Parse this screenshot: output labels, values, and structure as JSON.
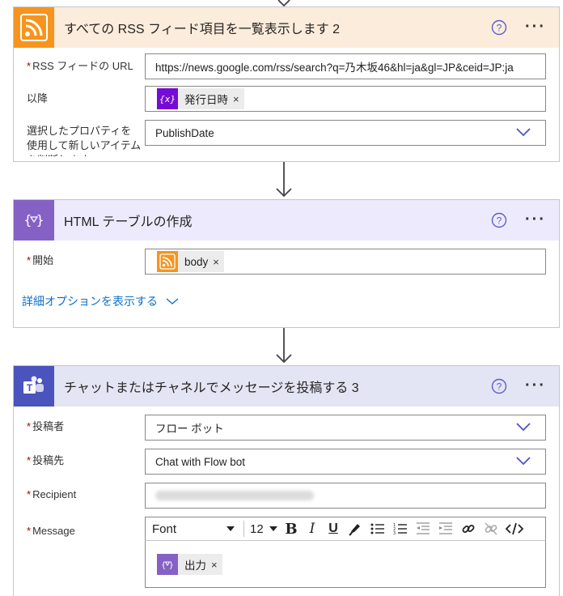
{
  "rss_card": {
    "title": "すべての RSS フィード項目を一覧表示します 2",
    "header_color": "#fcecdc",
    "icon_color": "#f7941d",
    "fields": {
      "url_label": "RSS フィードの URL",
      "url_value": "https://news.google.com/rss/search?q=乃木坂46&hl=ja&gl=JP&ceid=JP:ja",
      "since_label": "以降",
      "since_token": "発行日時",
      "prop_label": "選択したプロパティを使用して新しいアイテムを判断します",
      "prop_value": "PublishDate"
    }
  },
  "html_card": {
    "title": "HTML テーブルの作成",
    "header_color": "#eeeafd",
    "icon_color": "#8661c5",
    "fields": {
      "start_label": "開始",
      "start_token": "body",
      "advanced_link": "詳細オプションを表示する"
    }
  },
  "teams_card": {
    "title": "チャットまたはチャネルでメッセージを投稿する 3",
    "header_color": "#e4e5f4",
    "icon_color": "#4b53bc",
    "fields": {
      "poster_label": "投稿者",
      "poster_value": "フロー ボット",
      "postto_label": "投稿先",
      "postto_value": "Chat with Flow bot",
      "recipient_label": "Recipient",
      "message_label": "Message",
      "font_value": "Font",
      "size_value": "12",
      "message_token": "出力"
    }
  },
  "common": {
    "required_mark": "*",
    "remove_mark": "×",
    "more_mark": "···",
    "help_mark": "?"
  }
}
